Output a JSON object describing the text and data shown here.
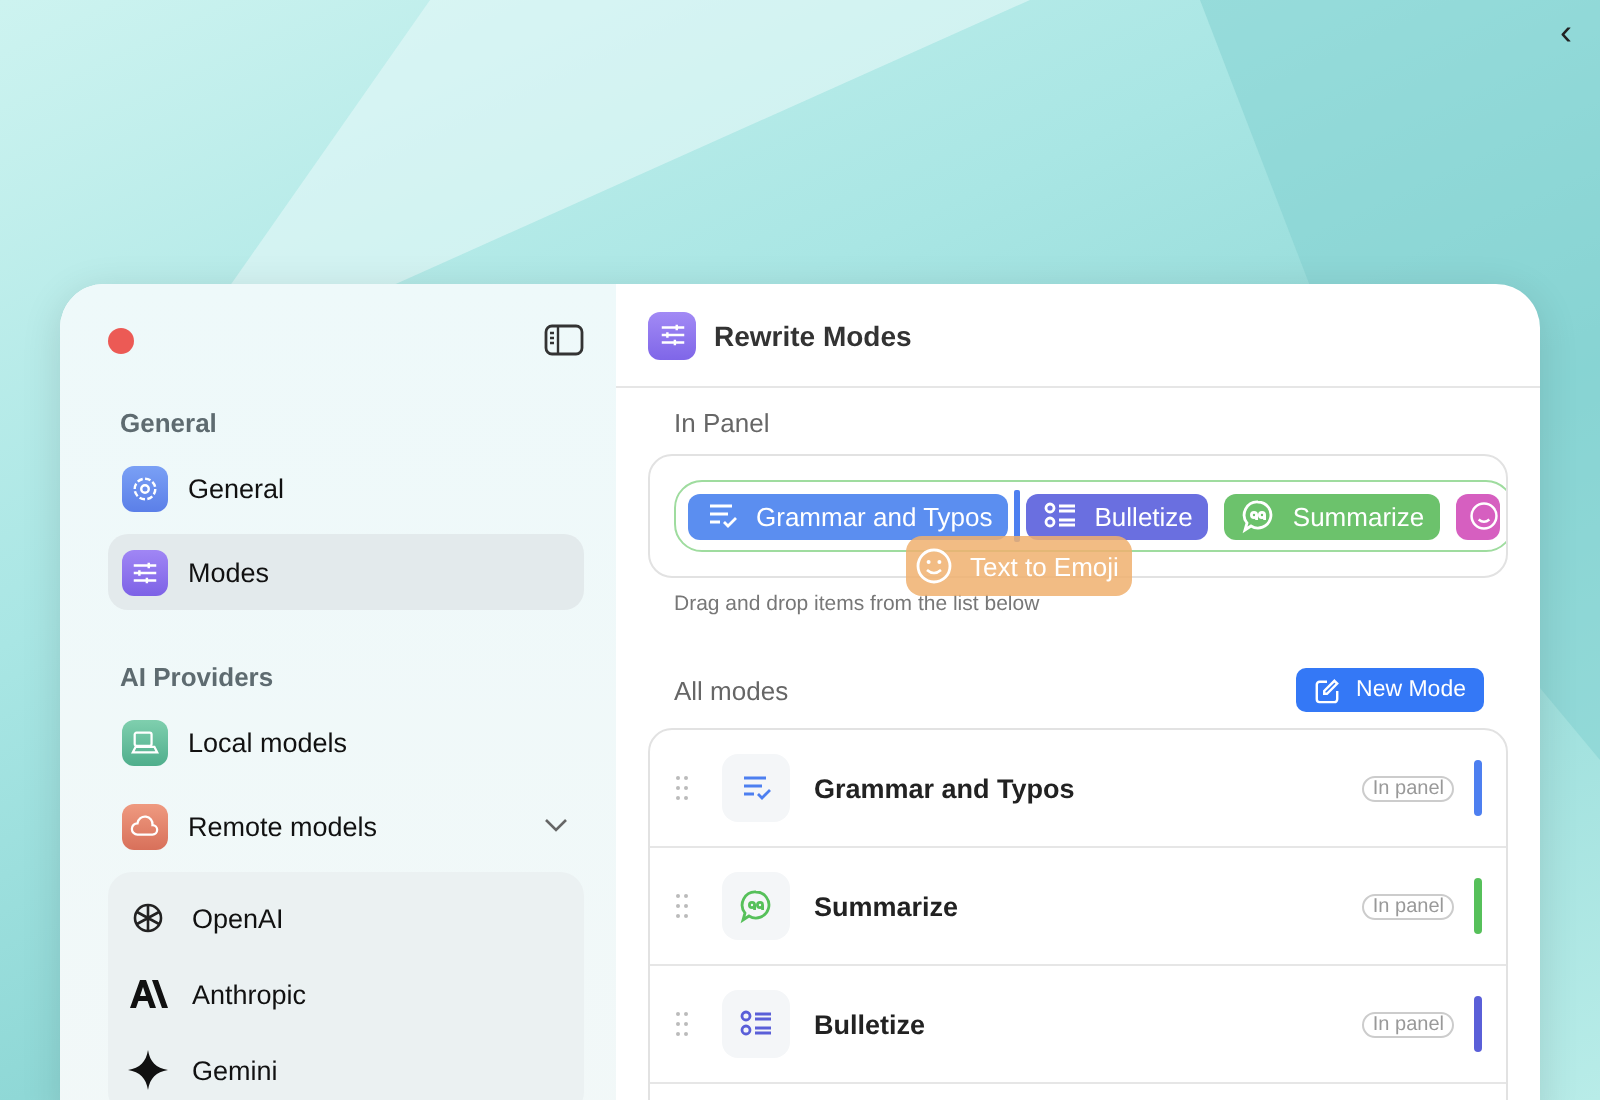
{
  "corner_glyph": "‹",
  "sidebar": {
    "sections": [
      {
        "title": "General",
        "items": [
          {
            "label": "General",
            "selected": false
          },
          {
            "label": "Modes",
            "selected": true
          }
        ]
      },
      {
        "title": "AI Providers",
        "items": [
          {
            "label": "Local models",
            "selected": false
          },
          {
            "label": "Remote models",
            "selected": false,
            "expanded": true,
            "children": [
              {
                "label": "OpenAI"
              },
              {
                "label": "Anthropic"
              },
              {
                "label": "Gemini"
              }
            ]
          }
        ]
      }
    ]
  },
  "header": {
    "title": "Rewrite Modes"
  },
  "in_panel": {
    "title": "In Panel",
    "chips": [
      {
        "label": "Grammar and Typos",
        "color": "#5b8ef0"
      },
      {
        "label": "Bulletize",
        "color": "#6a6fe0"
      },
      {
        "label": "Summarize",
        "color": "#6cc26c"
      },
      {
        "color": "#d65fc0"
      }
    ],
    "dragging": {
      "label": "Text to Emoji"
    },
    "hint": "Drag and drop items from the list below"
  },
  "all_modes": {
    "title": "All modes",
    "new_button": "New Mode",
    "modes": [
      {
        "name": "Grammar and Typos",
        "badge": "In panel",
        "color": "#4d7ff0"
      },
      {
        "name": "Summarize",
        "badge": "In panel",
        "color": "#56c05a"
      },
      {
        "name": "Bulletize",
        "badge": "In panel",
        "color": "#5a5fd8"
      }
    ]
  }
}
